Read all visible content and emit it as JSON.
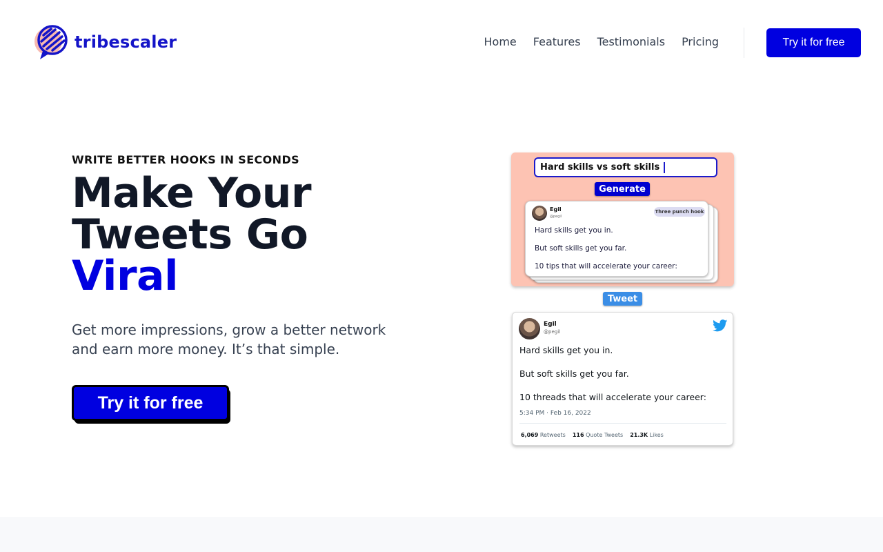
{
  "brand": {
    "name": "tribescaler",
    "accent": "#0000e0"
  },
  "nav": {
    "items": [
      "Home",
      "Features",
      "Testimonials",
      "Pricing"
    ],
    "cta": "Try it for free"
  },
  "hero": {
    "eyebrow": "WRITE BETTER HOOKS IN SECONDS",
    "headline_line1": "Make Your",
    "headline_line2": "Tweets Go",
    "headline_accent": "Viral",
    "subtext": "Get more impressions, grow a better network and earn more money. It’s that simple.",
    "cta": "Try it for free"
  },
  "generator": {
    "input_value": "Hard skills vs soft skills",
    "generate_label": "Generate",
    "preview": {
      "name": "Egil",
      "handle": "@pegil",
      "badge": "Three punch hook",
      "lines": [
        "Hard skills get you in.",
        "But soft skills get you far.",
        "10 tips that will accelerate your career:"
      ]
    },
    "tweet_label": "Tweet"
  },
  "tweet": {
    "name": "Egil",
    "handle": "@pegil",
    "lines": [
      "Hard skills get you in.",
      "But soft skills get you far.",
      "10 threads that will accelerate your career:"
    ],
    "time": "5:34 PM · Feb 16, 2022",
    "stats": {
      "retweets_count": "6,069",
      "retweets_label": "Retweets",
      "quotes_count": "116",
      "quotes_label": "Quote Tweets",
      "likes_count": "21.3K",
      "likes_label": "Likes"
    }
  }
}
